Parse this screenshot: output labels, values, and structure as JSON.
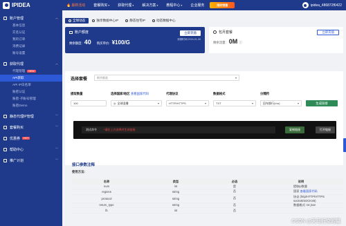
{
  "brand": {
    "name": "IPIDEA"
  },
  "topnav": {
    "items": [
      {
        "label": "最新活动",
        "hot": true,
        "caret": false
      },
      {
        "label": "套餐购买",
        "hot": false,
        "caret": true
      },
      {
        "label": "获取代理",
        "hot": false,
        "caret": true
      },
      {
        "label": "解决方案",
        "hot": false,
        "caret": true
      },
      {
        "label": "教程中心",
        "hot": false,
        "caret": true
      },
      {
        "label": "企业服务",
        "hot": false,
        "caret": false
      }
    ],
    "promo": "限时特惠",
    "user": "ipidea_486872f6422"
  },
  "sidebar": {
    "groups": [
      {
        "label": "账户管理",
        "items": [
          "基本信息",
          "实名认证",
          "我的订单",
          "消费记录",
          "账号设置"
        ]
      },
      {
        "label": "获取代理",
        "items": [
          "代理管理",
          "API获取",
          "API IP白名单",
          "账密认证",
          "账密-子账号管理",
          "账密Demo"
        ]
      },
      {
        "label": "静态代理IP管理",
        "items": []
      },
      {
        "label": "套餐购买",
        "items": []
      },
      {
        "label": "优惠券",
        "items": []
      },
      {
        "label": "帮助中心",
        "items": []
      },
      {
        "label": "推广计划",
        "items": []
      }
    ],
    "new_badge": "NEW",
    "hot_badge": "HOT"
  },
  "tabs": [
    "全球动态",
    "独享数据中心IP",
    "静态住宅IP",
    "动态数据中心"
  ],
  "account": {
    "title": "账户额度",
    "remaining_label": "剩余额度:",
    "remaining_value": "40",
    "price_label": "购买单价:",
    "price_value": "¥100/G",
    "button": "立即充值",
    "expiry": "到期时间:2024-01-06"
  },
  "package": {
    "title": "包月套餐",
    "button": "立即充值",
    "traffic_label": "剩余流量:",
    "traffic_value": "0M"
  },
  "select_pkg": {
    "title": "选择套餐",
    "placeholder": "剩余额度"
  },
  "fields": {
    "count_label": "提取数量",
    "count_value": "100",
    "region_label": "选择国家/地区",
    "region_hint": "查看国家代码",
    "region_value": "全球混播",
    "protocol_label": "代理协议",
    "protocol_value": "HTTP/HTTPS",
    "format_label": "数据格式",
    "format_value": "TXT",
    "sep_label": "分隔符",
    "sep_value": "回车换行(\\r\\n)",
    "generate": "生成链接"
  },
  "command": {
    "label": "测试命令",
    "hint": "*请在上方选择并生成链接",
    "copy": "复制链接",
    "open": "打开链接"
  },
  "api": {
    "title": "接口参数注释",
    "usage": "使用方法:",
    "headers": [
      "名称",
      "类型",
      "必选",
      "说明"
    ],
    "rows": [
      {
        "name": "num",
        "type": "int",
        "required": "是",
        "desc": "提取ip数量",
        "link": ""
      },
      {
        "name": "regions",
        "type": "string",
        "required": "否",
        "desc": "国家",
        "link": "查看国家代码"
      },
      {
        "name": "protocol",
        "type": "string",
        "required": "否",
        "desc": "协议 (http/HTTP/HTTPS socks5/SOCKS5)",
        "link": ""
      },
      {
        "name": "return_type",
        "type": "string",
        "required": "否",
        "desc": "数据格式: txt json",
        "link": ""
      },
      {
        "name": "lb",
        "type": "int",
        "required": "否",
        "desc": "",
        "link": ""
      }
    ]
  },
  "watermark": "CSDN @天马行空的猫"
}
